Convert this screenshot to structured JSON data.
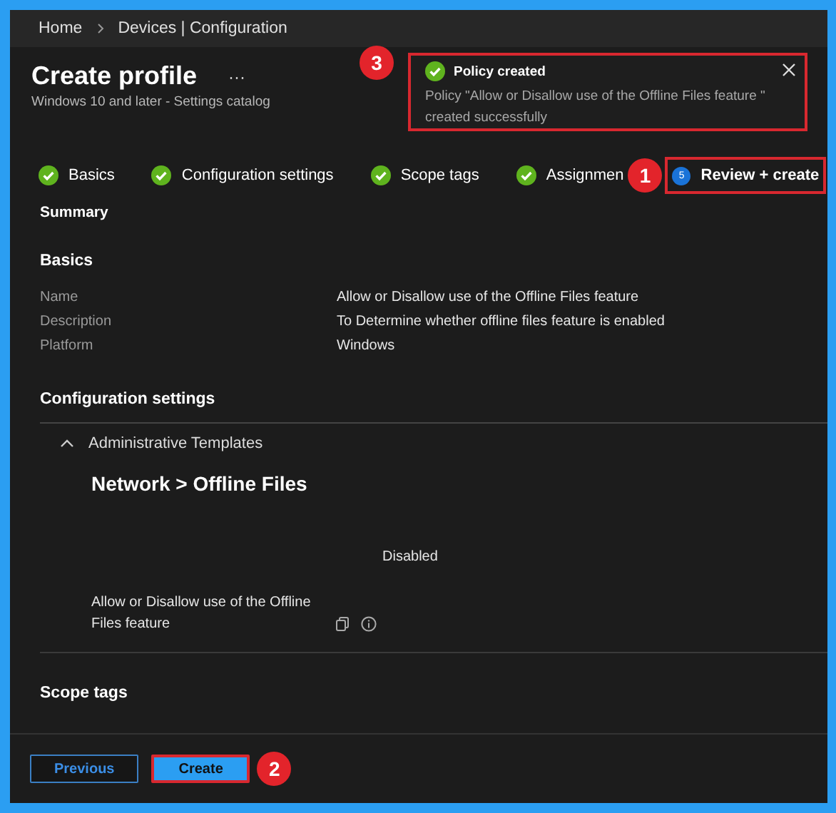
{
  "breadcrumb": [
    "Home",
    "Devices | Configuration"
  ],
  "header": {
    "title": "Create profile",
    "more": "···",
    "subtitle": "Windows 10 and later - Settings catalog"
  },
  "toast": {
    "title": "Policy created",
    "message": "Policy \"Allow or Disallow use of the Offline Files feature \" created successfully",
    "callout": "3"
  },
  "steps": [
    {
      "label": "Basics",
      "done": true,
      "selected": false
    },
    {
      "label": "Configuration settings",
      "done": true,
      "selected": false
    },
    {
      "label": "Scope tags",
      "done": true,
      "selected": false
    },
    {
      "label": "Assignmen",
      "done": true,
      "selected": false,
      "callout": "1"
    },
    {
      "label": "Review + create",
      "number": "5",
      "done": false,
      "selected": true
    }
  ],
  "summary_title": "Summary",
  "basics": {
    "title": "Basics",
    "rows": [
      {
        "key": "Name",
        "value": "Allow or Disallow use of the Offline Files feature"
      },
      {
        "key": "Description",
        "value": "To Determine whether offline files feature is enabled"
      },
      {
        "key": "Platform",
        "value": "Windows"
      }
    ]
  },
  "configuration": {
    "title": "Configuration settings",
    "group": {
      "title": "Administrative Templates",
      "expanded": true,
      "category": "Network > Offline Files",
      "settings": [
        {
          "label": "Allow or Disallow use of the Offline Files feature",
          "value": "Disabled"
        }
      ]
    }
  },
  "scope_tags_title": "Scope tags",
  "footer": {
    "buttons": [
      {
        "label": "Previous",
        "kind": "secondary"
      },
      {
        "label": "Create",
        "kind": "primary",
        "callout": "2"
      }
    ]
  }
}
